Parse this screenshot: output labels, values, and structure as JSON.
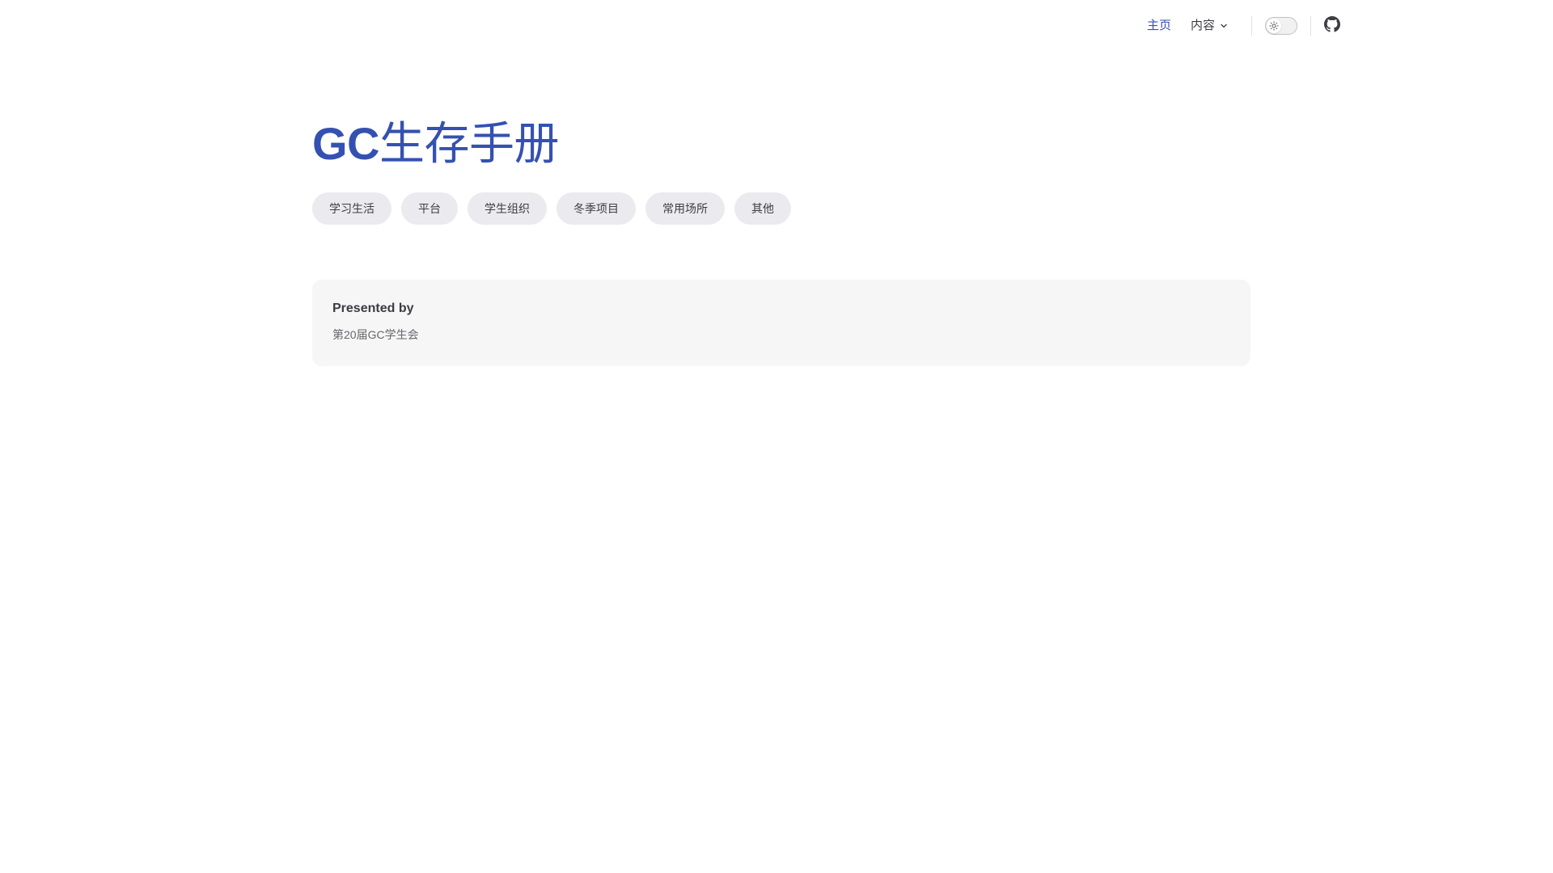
{
  "nav": {
    "home_label": "主页",
    "content_label": "内容",
    "theme_toggle_icon": "sun-icon",
    "github_icon": "github-icon"
  },
  "hero": {
    "title_en": "GC",
    "title_cn": "生存手册",
    "tags": [
      "学习生活",
      "平台",
      "学生组织",
      "冬季项目",
      "常用场所",
      "其他"
    ]
  },
  "feature": {
    "title": "Presented by",
    "details": "第20届GC学生会"
  },
  "colors": {
    "brand": "#3451b2",
    "text": "#3c3c43",
    "tag_bg": "#ebebef",
    "card_bg": "#f6f6f7"
  }
}
